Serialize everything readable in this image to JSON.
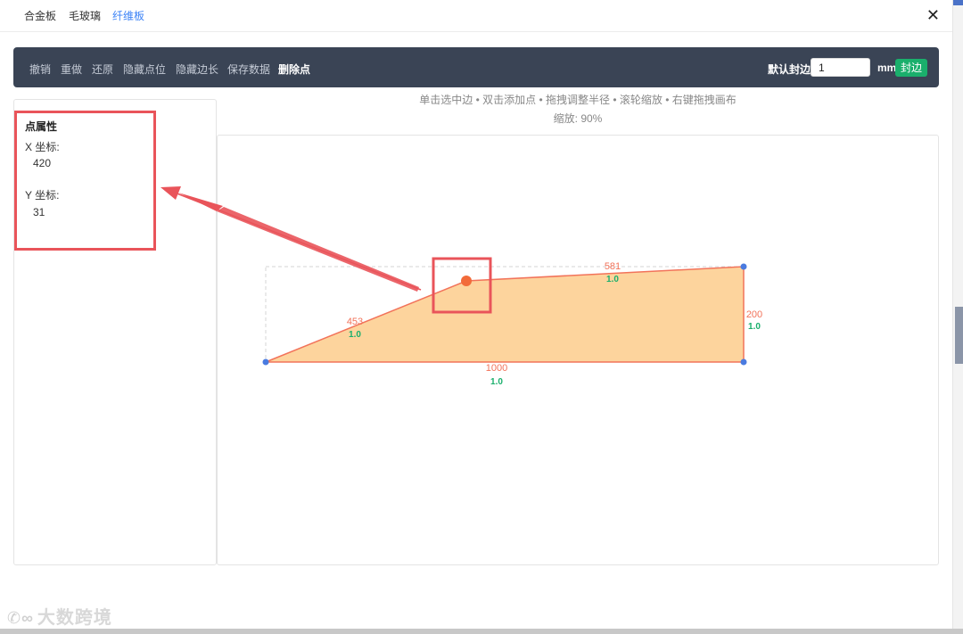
{
  "tabs": [
    {
      "label": "合金板",
      "active": false
    },
    {
      "label": "毛玻璃",
      "active": false
    },
    {
      "label": "纤维板",
      "active": true
    }
  ],
  "close_icon": "close-icon",
  "toolbar": {
    "buttons": [
      "撤销",
      "重做",
      "还原",
      "隐藏点位",
      "隐藏边长",
      "保存数据",
      "删除点"
    ],
    "edge_label": "默认封边:",
    "edge_value": "1",
    "unit": "mm",
    "seal_button": "封边"
  },
  "panel": {
    "title": "点属性",
    "x_label": "X 坐标:",
    "x_value": "420",
    "y_label": "Y 坐标:",
    "y_value": "31"
  },
  "hint": "单击选中边 • 双击添加点 • 拖拽调整半径 • 滚轮缩放 • 右键拖拽画布",
  "zoom": "缩放: 90%",
  "shape": {
    "fill": "#fdd49d",
    "stroke": "#f2735a",
    "vertex_color": "#4a7be0",
    "selected_color": "#f26b3a",
    "edges": [
      {
        "length": "453",
        "edge": "1.0"
      },
      {
        "length": "581",
        "edge": "1.0"
      },
      {
        "length": "200",
        "edge": "1.0"
      },
      {
        "length": "1000",
        "edge": "1.0"
      }
    ]
  },
  "watermark": "大数跨境",
  "accent_colors": {
    "tab_active": "#3b82f6",
    "toolbar_bg": "#3a4455",
    "seal_button": "#1aaf6c",
    "annotation": "#e9545a",
    "edge_value": "#1aaf6c"
  }
}
